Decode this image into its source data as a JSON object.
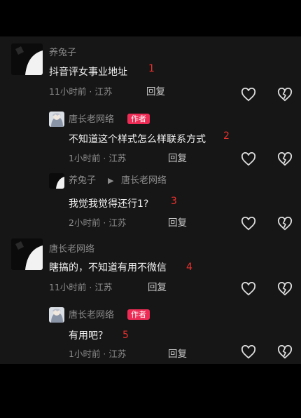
{
  "comments": [
    {
      "author": "养兔子",
      "text": "抖音评女事业地址",
      "marker": "1",
      "meta": "11小时前 · 江苏",
      "reply_label": "回复"
    },
    {
      "author": "唐长老网络",
      "badge": "作者",
      "text": "不知道这个样式怎么样联系方式",
      "marker": "2",
      "meta": "1小时前 · 江苏",
      "reply_label": "回复"
    },
    {
      "author": "养兔子",
      "reply_arrow": "▶",
      "reply_to": "唐长老网络",
      "text": "我觉我觉得还行1?",
      "marker": "3",
      "meta": "2小时前 · 江苏",
      "reply_label": "回复"
    },
    {
      "author": "唐长老网络",
      "text": "瞎搞的，不知道有用不微信",
      "marker": "4",
      "meta": "11小时前 · 江苏",
      "reply_label": "回复"
    },
    {
      "author": "唐长老网络",
      "badge": "作者",
      "text": "有用吧？",
      "marker": "5",
      "meta": "1小时前 · 江苏",
      "reply_label": "回复"
    }
  ],
  "icons": {
    "like": "heart-outline-icon",
    "dislike": "broken-heart-icon"
  },
  "colors": {
    "background": "#161616",
    "badge": "#ee2b55",
    "marker": "#e8312e"
  }
}
